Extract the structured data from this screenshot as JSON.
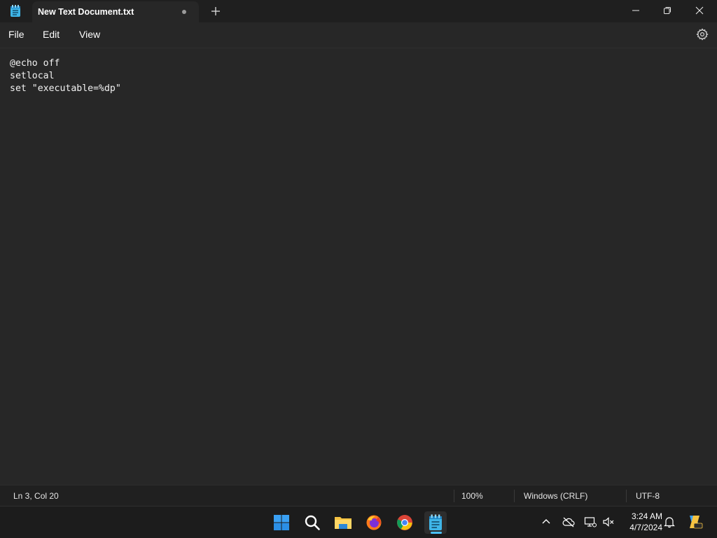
{
  "window": {
    "tab_title": "New Text Document.txt",
    "app_icon": "notepad-icon",
    "controls": [
      "minimize-icon",
      "maximize-icon",
      "close-icon"
    ]
  },
  "menu": {
    "file": "File",
    "edit": "Edit",
    "view": "View",
    "settings_icon": "gear-icon"
  },
  "editor": {
    "lines": [
      "@echo off",
      "setlocal",
      "set \"executable=%dp\""
    ]
  },
  "statusbar": {
    "position": "Ln 3, Col 20",
    "zoom": "100%",
    "line_ending": "Windows (CRLF)",
    "encoding": "UTF-8"
  },
  "taskbar": {
    "apps": [
      "windows-start-icon",
      "search-icon",
      "file-explorer-icon",
      "firefox-icon",
      "chrome-icon",
      "notepad-icon"
    ],
    "active_app": "notepad-icon",
    "tray": [
      "chevron-up-icon",
      "onedrive-icon",
      "network-icon",
      "volume-muted-icon",
      "bell-icon",
      "copilot-icon"
    ],
    "time": "3:24 AM",
    "date": "4/7/2024"
  },
  "colors": {
    "editor_bg": "#272727",
    "titlebar_bg": "#1f1f1f",
    "taskbar_bg": "#1c1c1c",
    "accent": "#4cc2ff"
  }
}
